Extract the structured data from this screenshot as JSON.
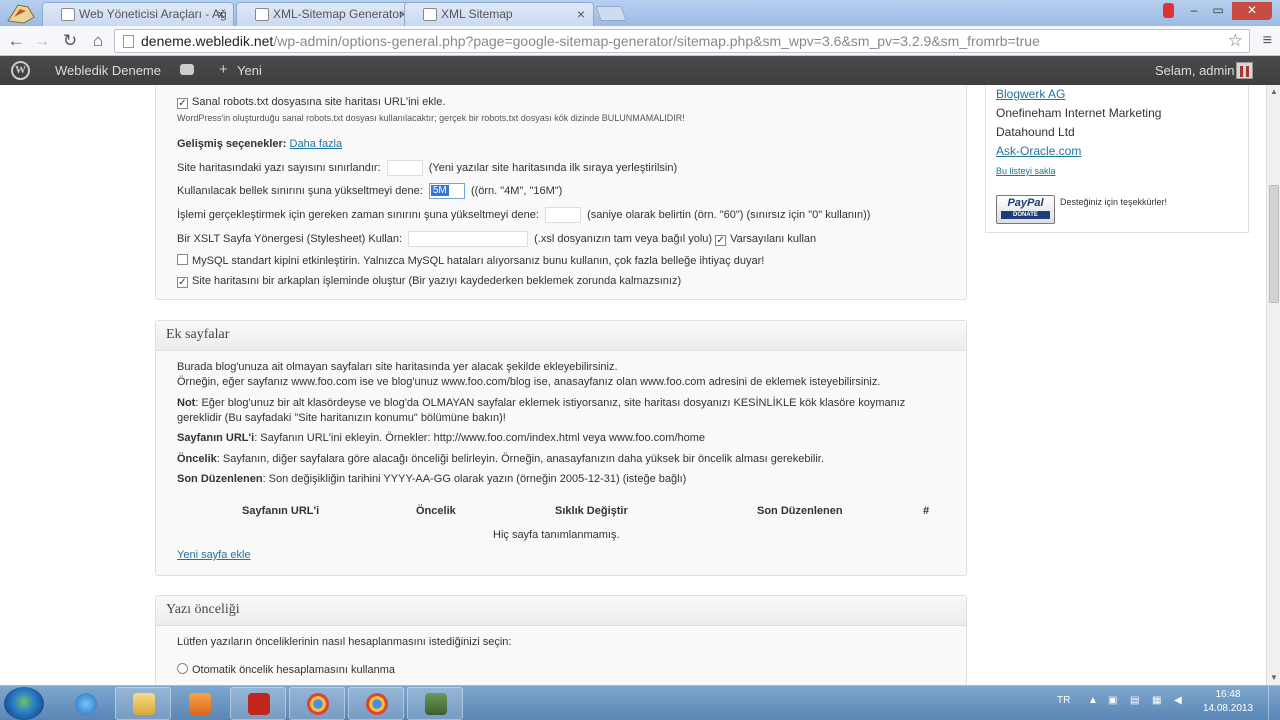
{
  "browser": {
    "tabs": [
      {
        "title": "Web Yöneticisi Araçları - Ağ",
        "active": false
      },
      {
        "title": "XML-Sitemap Generator »",
        "active": true
      },
      {
        "title": "XML Sitemap",
        "active": false
      }
    ],
    "url_host": "deneme.webledik.net",
    "url_path": "/wp-admin/options-general.php?page=google-sitemap-generator/sitemap.php&sm_wpv=3.6&sm_pv=3.2.9&sm_fromrb=true"
  },
  "adminbar": {
    "site_name": "Webledik Deneme",
    "new_label": "Yeni",
    "greeting": "Selam, admin"
  },
  "settings": {
    "robots_label": "Sanal robots.txt dosyasına site haritası URL'ini ekle.",
    "robots_note": "WordPress'in oluşturduğu sanal robots.txt dosyası kullanılacaktır; gerçek bir robots.txt dosyası kök dizinde BULUNMAMALIDIR!",
    "advanced_label": "Gelişmiş seçenekler:",
    "advanced_link": "Daha fazla",
    "post_limit_label": "Site haritasındaki yazı sayısını sınırlandır:",
    "post_limit_hint": "(Yeni yazılar site haritasında ilk sıraya yerleştirilsin)",
    "memory_label": "Kullanılacak bellek sınırını şuna yükseltmeyi dene:",
    "memory_value": "5M",
    "memory_hint": "((örn. \"4M\", \"16M\")",
    "time_label": "İşlemi gerçekleştirmek için gereken zaman sınırını şuna yükseltmeyi dene:",
    "time_hint": "(saniye olarak belirtin (örn. \"60\") (sınırsız için \"0\" kullanın))",
    "xslt_label": "Bir XSLT Sayfa Yönergesi (Stylesheet) Kullan:",
    "xslt_hint": "(.xsl dosyanızın tam veya bağıl yolu)",
    "xslt_default_label": "Varsayılanı kullan",
    "mysql_label": "MySQL standart kipini etkinleştirin. Yalnızca MySQL hataları alıyorsanız bunu kullanın, çok fazla belleğe ihtiyaç duyar!",
    "background_label": "Site haritasını bir arkaplan işleminde oluştur (Bir yazıyı kaydederken beklemek zorunda kalmazsınız)"
  },
  "extra_pages": {
    "title": "Ek sayfalar",
    "intro1": "Burada blog'unuza ait olmayan sayfaları site haritasında yer alacak şekilde ekleyebilirsiniz.",
    "intro2": "Örneğin, eğer sayfanız www.foo.com ise ve blog'unuz www.foo.com/blog ise, anasayfanız olan www.foo.com adresini de eklemek isteyebilirsiniz.",
    "note_label": "Not",
    "note_text": ": Eğer blog'unuz bir alt klasördeyse ve blog'da OLMAYAN sayfalar eklemek istiyorsanız, site haritası dosyanızı KESİNLİKLE kök klasöre koymanız",
    "note_text2": "gereklidir (Bu sayfadaki \"Site haritanızın konumu\" bölümüne bakın)!",
    "url_label": "Sayfanın URL'i",
    "url_text": ": Sayfanın URL'ini ekleyin. Örnekler: http://www.foo.com/index.html veya www.foo.com/home",
    "priority_label": "Öncelik",
    "priority_text": ": Sayfanın, diğer sayfalara göre alacağı önceliği belirleyin. Örneğin, anasayfanızın daha yüksek bir öncelik alması gerekebilir.",
    "lastmod_label": "Son Düzenlenen",
    "lastmod_text": ": Son değişikliğin tarihini YYYY-AA-GG olarak yazın (örneğin 2005-12-31) (isteğe bağlı)",
    "columns": [
      "Sayfanın URL'i",
      "Öncelik",
      "Sıklık Değiştir",
      "Son Düzenlenen",
      "#"
    ],
    "empty_text": "Hiç sayfa tanımlanmamış.",
    "add_link": "Yeni sayfa ekle"
  },
  "post_priority": {
    "title": "Yazı önceliği",
    "prompt": "Lütfen yazıların önceliklerinin nasıl hesaplanmasını istediğinizi seçin:",
    "option1": "Otomatik öncelik hesaplamasını kullanma"
  },
  "sidebar": {
    "sponsors": [
      "Blogwerk AG",
      "Onefineham Internet Marketing",
      "Datahound Ltd",
      "Ask-Oracle.com"
    ],
    "hide_link": "Bu listeyi sakla",
    "paypal_label": "PayPal",
    "paypal_sub": "DONATE",
    "thanks": "Desteğiniz için teşekkürler!"
  },
  "taskbar": {
    "lang": "TR",
    "time": "16:48",
    "date": "14.08.2013"
  }
}
